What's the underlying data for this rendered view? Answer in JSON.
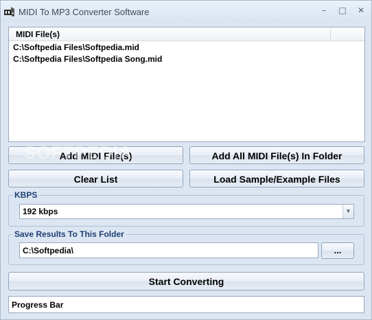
{
  "window": {
    "title": "MIDI To MP3 Converter Software",
    "controls": {
      "minimize": "–",
      "maximize": "□",
      "close": "✕"
    }
  },
  "file_list": {
    "column_header": "MIDI File(s)",
    "rows": [
      "C:\\Softpedia Files\\Softpedia.mid",
      "C:\\Softpedia Files\\Softpedia Song.mid"
    ]
  },
  "buttons": {
    "add_midi": "Add MIDI File(s)",
    "add_all_folder": "Add All MIDI File(s) In Folder",
    "clear_list": "Clear List",
    "load_sample": "Load Sample/Example Files",
    "browse": "...",
    "start_converting": "Start Converting"
  },
  "kbps": {
    "label": "KBPS",
    "selected": "192 kbps"
  },
  "save_folder": {
    "label": "Save Results To This Folder",
    "value": "C:\\Softpedia\\"
  },
  "progress": {
    "label": "Progress Bar"
  },
  "watermark": "SOFTPEDIA"
}
